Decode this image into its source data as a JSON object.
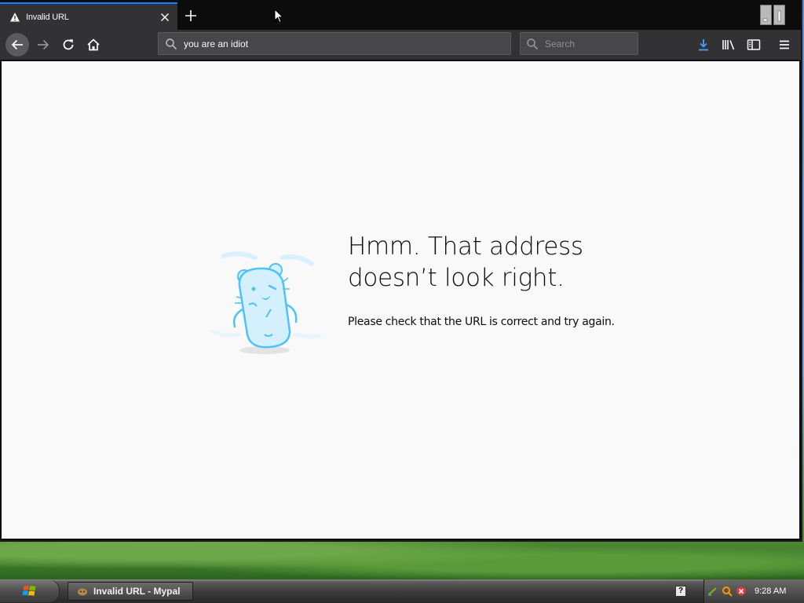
{
  "browser": {
    "tab": {
      "title": "Invalid URL",
      "close_icon": "close-icon",
      "status_icon": "warning-icon"
    },
    "toolbar": {
      "url": "you are an idiot",
      "search_placeholder": "Search"
    }
  },
  "error_page": {
    "title": "Hmm. That address doesn’t look right.",
    "description": "Please check that the URL is correct and try again."
  },
  "taskbar": {
    "task_label": "Invalid URL - Mypal",
    "clock": "9:28 AM",
    "help_glyph": "?"
  },
  "colors": {
    "accent": "#0a84ff",
    "toolbar_bg": "#323234",
    "tab_strip_bg": "#0c0c0d",
    "page_bg": "#f9f9fa",
    "illustration": "#4fc3f7"
  }
}
